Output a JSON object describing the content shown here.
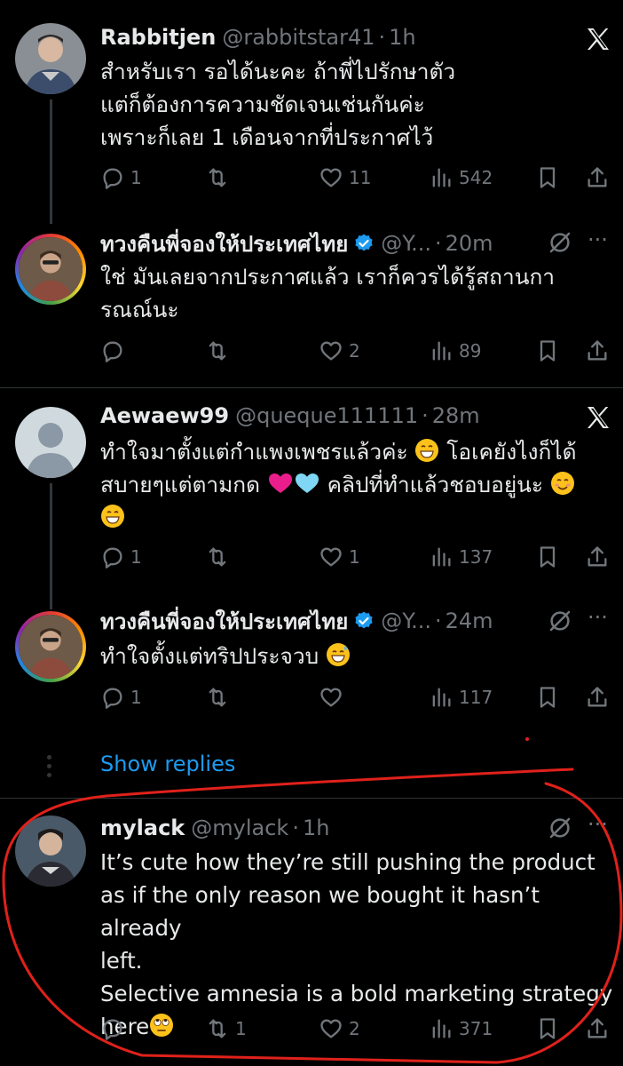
{
  "tweets": [
    {
      "name": "Rabbitjen",
      "handle": "@rabbitstar41",
      "time": "1h",
      "text_lines": [
        "สำหรับเรา รอได้นะคะ ถ้าพี่ไปรักษาตัว",
        "แต่ก็ต้องการความชัดเจนเช่นกันค่ะ",
        "เพราะก็เลย 1 เดือนจากที่ประกาศไว้"
      ],
      "replies": "1",
      "retweets": "",
      "likes": "11",
      "views": "542"
    },
    {
      "name": "ทวงคืนพี่จองให้ประเทศไทย",
      "handle": "@Y...",
      "time": "20m",
      "verified": true,
      "text_lines": [
        "ใช่ มันเลยจากประกาศแล้ว เราก็ควรได้รู้สถานกา",
        "รณณ์นะ"
      ],
      "replies": "",
      "retweets": "",
      "likes": "2",
      "views": "89"
    },
    {
      "name": "Aewaew99",
      "handle": "@queque111111",
      "time": "28m",
      "text_lines": [
        "ทำใจมาตั้งแต่กำแพงเพชรแล้วค่ะ",
        "โอเคยังไงก็ได้",
        "สบายๆแต่ตามกด",
        "คลิปที่ทำแล้วชอบอยู่นะ"
      ],
      "replies": "1",
      "retweets": "",
      "likes": "1",
      "views": "137"
    },
    {
      "name": "ทวงคืนพี่จองให้ประเทศไทย",
      "handle": "@Y...",
      "time": "24m",
      "verified": true,
      "text_lines": [
        "ทำใจตั้งแต่ทริปประจวบ"
      ],
      "replies": "1",
      "retweets": "",
      "likes": "",
      "views": "117"
    },
    {
      "name": "mylack",
      "handle": "@mylack",
      "time": "1h",
      "text_lines": [
        "It’s cute how they’re still pushing the product",
        "as if the only reason we bought it hasn’t already",
        "left.",
        "Selective amnesia is a bold marketing strategy",
        "here"
      ],
      "replies": "",
      "retweets": "1",
      "likes": "2",
      "views": "371"
    }
  ],
  "show_replies_label": "Show replies",
  "colors": {
    "accent": "#1d9bf0",
    "muted": "#71767b",
    "annotation": "#e0211b"
  }
}
